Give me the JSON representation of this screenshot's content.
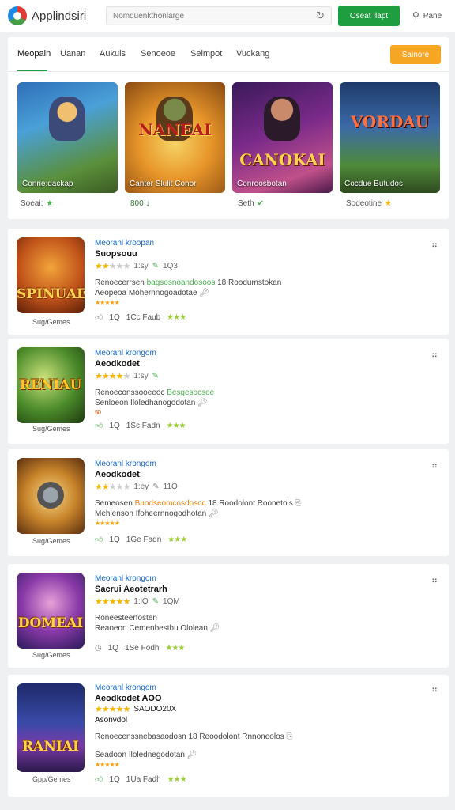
{
  "header": {
    "app_title": "Applindsiri",
    "search_placeholder": "Nomduenkthonlarge",
    "primary_button": "Oseat Ilapt",
    "profile_label": "Pane"
  },
  "tabs": [
    "Meopain",
    "Uanan",
    "Aukuis",
    "Senoeoe",
    "Selmpot",
    "Vuckang"
  ],
  "orange_button": "Sainore",
  "featured": [
    {
      "title": "",
      "caption": "Conrie:dackap",
      "meta": "Soeai:",
      "meta_icon": "★"
    },
    {
      "title": "NANEAI",
      "caption": "Canter Slulit Conor",
      "meta": "800 ↓",
      "meta_icon": ""
    },
    {
      "title": "CANOKAI",
      "caption": "Conroosbotan",
      "meta": "Seth",
      "meta_icon": "✔"
    },
    {
      "title": "VORDAU",
      "caption": "Cocdue Butudos",
      "meta": "Sodeotine",
      "meta_icon": "★"
    }
  ],
  "apps": [
    {
      "developer": "Meoranl kroopan",
      "name": "Suopsouu",
      "rating_count": "1:sy",
      "rating_extra": "1Q3",
      "desc_line1_a": "Renoecerrsen",
      "desc_line1_hl": "bagsosnoandosoos",
      "desc_line1_b": "18 Roodumstokan",
      "desc_line2": "Aeopeoa Mohernnogoadotae",
      "mini_stars": "★★★★★",
      "stats_a": "1Q",
      "stats_b": "1Cc Faub",
      "genre": "Sug/Gemes",
      "thumb_word": "SPINUAE"
    },
    {
      "developer": "Meoranl krongom",
      "name": "Aeodkodet",
      "rating_count": "1:sy",
      "rating_extra": "",
      "desc_line1_a": "Renoeconssooeeoc",
      "desc_line1_hl": "Besgesocsoe",
      "desc_line1_b": "",
      "desc_line2": "Senloeon Iloledhanogodotan",
      "mini_stars": "50",
      "stats_a": "1Q",
      "stats_b": "1Sc Fadn",
      "genre": "Sug/Gemes",
      "thumb_word": "RENIAU"
    },
    {
      "developer": "Meoranl krongom",
      "name": "Aeodkodet",
      "rating_count": "1:ey",
      "rating_extra": "11Q",
      "desc_line1_a": "Semeosen",
      "desc_line1_hl": "Buodseomcosdosnc",
      "desc_line1_b": "18 Roodolont Roonetois",
      "desc_line2": "Mehlenson Ifoheernnogodhotan",
      "mini_stars": "★★★★★",
      "stats_a": "1Q",
      "stats_b": "1Ge Fadn",
      "genre": "Sug/Gemes",
      "thumb_word": ""
    },
    {
      "developer": "Meoranl krongom",
      "name": "Sacrui Aeotetrarh",
      "rating_count": "1:lO",
      "rating_extra": "1QM",
      "desc_line1_a": "Roneesteerfosten",
      "desc_line1_hl": "",
      "desc_line1_b": "",
      "desc_line2": "Reaoeon Cemenbesthu Ololean",
      "mini_stars": "",
      "stats_a": "1Q",
      "stats_b": "1Se Fodh",
      "genre": "Sug/Gemes",
      "thumb_word": "DOMEAI"
    },
    {
      "developer": "Meoranl krongom",
      "name": "Aeodkodet AOO",
      "rating_count": "SAODO20X",
      "rating_extra": "",
      "name_sub": "Asonvdol",
      "desc_line1_a": "Renoecenssnebasaodosn",
      "desc_line1_hl": "",
      "desc_line1_b": "18 Reoodolont Rnnoneolos",
      "desc_line2": "Seadoon Ilolednegodotan",
      "mini_stars": "★★★★★",
      "stats_a": "1Q",
      "stats_b": "1Ua Fadh",
      "genre": "Gpp/Gemes",
      "thumb_word": "RANIAI"
    }
  ],
  "colors": {
    "accent_green": "#1e9e3f",
    "accent_orange": "#f5a623",
    "link_blue": "#1565c0"
  }
}
